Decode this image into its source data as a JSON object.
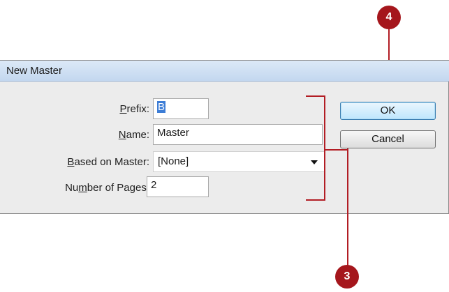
{
  "dialog": {
    "title": "New Master",
    "fields": {
      "prefix": {
        "label_ul": "P",
        "label_rest": "refix:",
        "value": "B"
      },
      "name": {
        "label_ul": "N",
        "label_rest": "ame:",
        "value": "Master"
      },
      "based_on": {
        "label_ul": "B",
        "label_rest": "ased on Master:",
        "value": "[None]"
      },
      "pages": {
        "label_pre": "Nu",
        "label_ul": "m",
        "label_rest": "ber of Pages:",
        "value": "2"
      }
    },
    "buttons": {
      "ok": "OK",
      "cancel": "Cancel"
    }
  },
  "callouts": {
    "ok_number": "4",
    "fields_number": "3"
  },
  "colors": {
    "callout": "#a5161c",
    "accent_select": "#3d7dd6"
  }
}
